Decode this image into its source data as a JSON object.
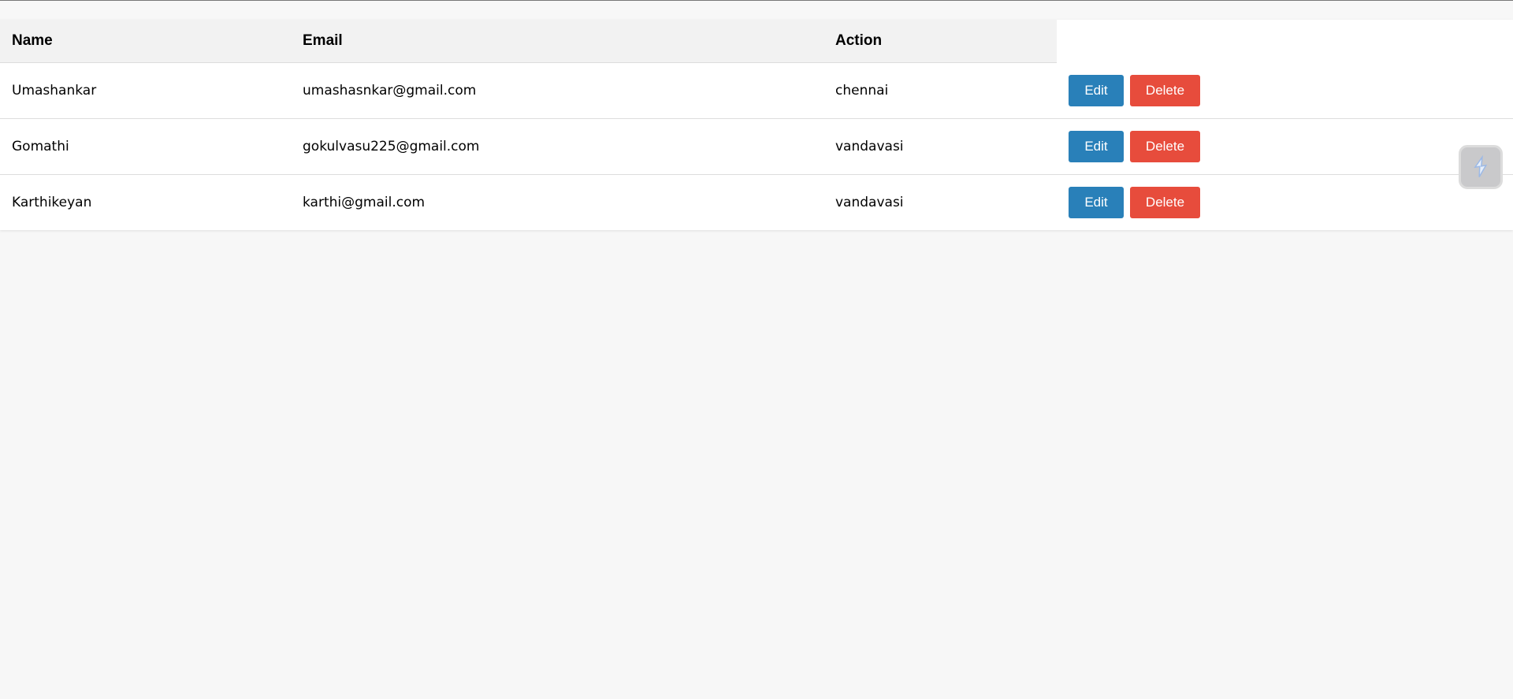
{
  "table": {
    "headers": {
      "name": "Name",
      "email": "Email",
      "action": "Action"
    },
    "rows": [
      {
        "name": "Umashankar",
        "email": "umashasnkar@gmail.com",
        "city": "chennai"
      },
      {
        "name": "Gomathi",
        "email": "gokulvasu225@gmail.com",
        "city": "vandavasi"
      },
      {
        "name": "Karthikeyan",
        "email": "karthi@gmail.com",
        "city": "vandavasi"
      }
    ]
  },
  "buttons": {
    "edit_label": "Edit",
    "delete_label": "Delete"
  },
  "floating_widget": {
    "icon": "lightning-bolt-icon"
  },
  "colors": {
    "edit": "#2980b9",
    "delete": "#e74c3c",
    "header_bg": "#f2f2f2",
    "page_bg": "#f7f7f7"
  }
}
